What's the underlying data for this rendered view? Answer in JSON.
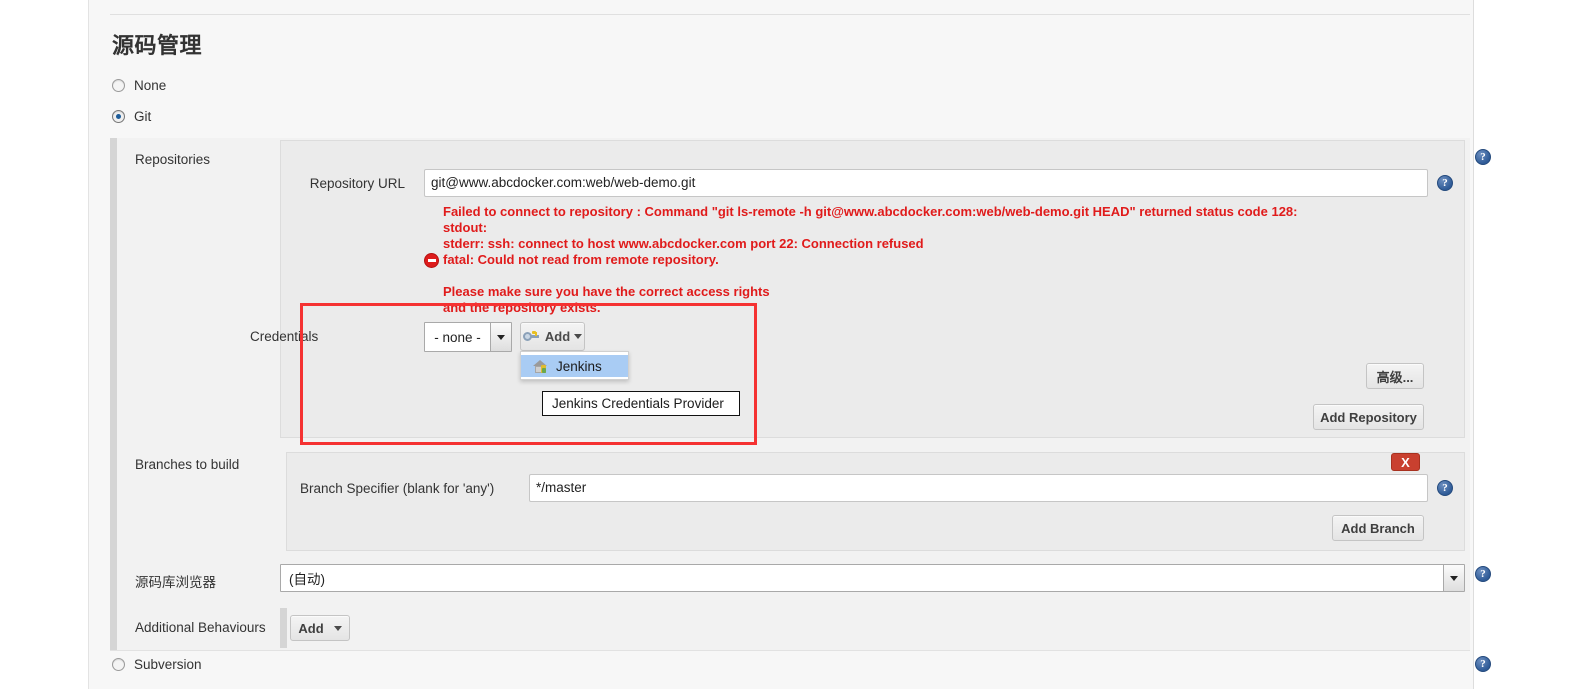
{
  "page": {
    "title": "源码管理"
  },
  "scm_options": [
    {
      "label": "None",
      "checked": false
    },
    {
      "label": "Git",
      "checked": true
    },
    {
      "label": "Subversion",
      "checked": false
    }
  ],
  "repositories": {
    "section_label": "Repositories",
    "url_label": "Repository URL",
    "url_value": "git@www.abcdocker.com:web/web-demo.git",
    "error": {
      "icon": "error-circle-icon",
      "lines": [
        "Failed to connect to repository : Command \"git ls-remote -h git@www.abcdocker.com:web/web-demo.git HEAD\" returned status code 128:",
        "stdout:",
        "stderr: ssh: connect to host www.abcdocker.com port 22: Connection refused",
        "fatal: Could not read from remote repository.",
        "",
        "Please make sure you have the correct access rights",
        "and the repository exists."
      ]
    },
    "credentials_label": "Credentials",
    "credentials_value": "- none -",
    "add_button_label": "Add",
    "add_button_icon": "key-icon",
    "menu": {
      "items": [
        {
          "label": "Jenkins",
          "icon": "jenkins-house-icon",
          "highlighted": true
        }
      ]
    },
    "tooltip": "Jenkins Credentials Provider",
    "advanced_button_label": "高级...",
    "add_repository_button_label": "Add Repository"
  },
  "branches": {
    "section_label": "Branches to build",
    "specifier_label": "Branch Specifier (blank for 'any')",
    "specifier_value": "*/master",
    "delete_button_label": "X",
    "add_branch_button_label": "Add Branch"
  },
  "repo_browser": {
    "label": "源码库浏览器",
    "value": "(自动)"
  },
  "additional_behaviours": {
    "label": "Additional Behaviours",
    "add_button_label": "Add"
  },
  "help_icon_glyph": "?",
  "colors": {
    "error_red": "#e01b1b",
    "annotation_red": "#f53232",
    "delete_red": "#c9402f",
    "help_blue": "#2f5b97",
    "radio_blue": "#1d5c99",
    "menu_highlight": "#a9ccf4"
  }
}
